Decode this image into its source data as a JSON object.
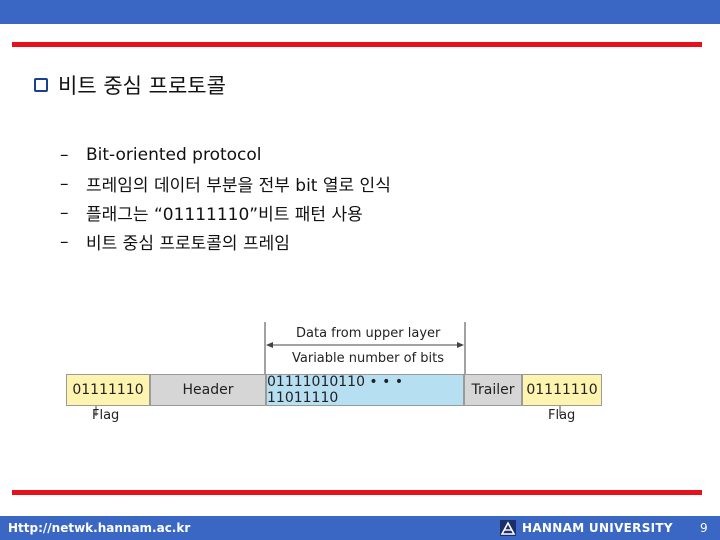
{
  "slide": {
    "title": "비트 중심 프로토콜",
    "bullets": [
      {
        "marker": "–",
        "text": "Bit-oriented protocol"
      },
      {
        "marker": "–",
        "text": "프레임의 데이터 부분을 전부 bit 열로 인식"
      },
      {
        "marker": "–",
        "text": "플래그는 “01111110”비트 패턴 사용"
      },
      {
        "marker": "–",
        "text": "비트 중심 프로토콜의 프레임"
      }
    ]
  },
  "diagram": {
    "top_label": "Data from upper layer",
    "sub_label": "Variable number of bits",
    "segments": [
      {
        "label": "01111110",
        "kind": "flag"
      },
      {
        "label": "Header",
        "kind": "header"
      },
      {
        "label": "01111010110 • • • 11011110",
        "kind": "data"
      },
      {
        "label": "Trailer",
        "kind": "trailer"
      },
      {
        "label": "01111110",
        "kind": "flag"
      }
    ],
    "flag_label_left": "Flag",
    "flag_label_right": "Flag"
  },
  "footer": {
    "url": "Http://netwk.hannam.ac.kr",
    "university": "HANNAM UNIVERSITY",
    "page_number": "9"
  },
  "colors": {
    "bar_blue": "#3a67c4",
    "rule_red": "#e8101a",
    "flag_fill": "#fff3b0",
    "header_fill": "#d6d6d6",
    "data_fill": "#b7dff2"
  }
}
